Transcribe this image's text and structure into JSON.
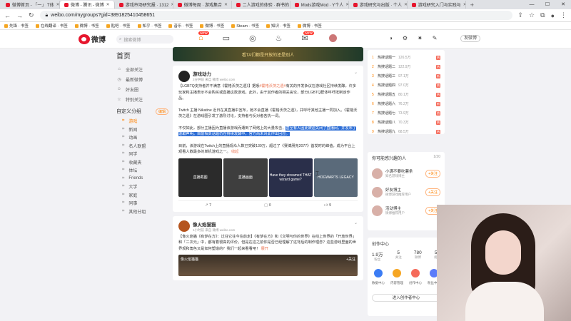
{
  "browser": {
    "tabs": [
      {
        "label": "微博首页 - 「一」 T体",
        "active": false
      },
      {
        "label": "微博 - 腾讯 - 微博",
        "active": true
      },
      {
        "label": "游戏市场研究报 · 1312",
        "active": false
      },
      {
        "label": "微博每周 · 游戏集合",
        "active": false
      },
      {
        "label": "二人游戏的体验 · 群书的",
        "active": false
      },
      {
        "label": "Mods游戏Mod · Y个人",
        "active": false
      },
      {
        "label": "游戏研究与出版 · 个人",
        "active": false
      },
      {
        "label": "游戏研究入门与实践与",
        "active": false
      }
    ],
    "url": "weibo.com/mygroups?gid=3891825410458651",
    "bookmarks": [
      "先锋 · 书签",
      "在线翻译 · 书签",
      "微博 · 书签",
      "贴吧 · 书签",
      "知乎 · 书签",
      "音乐 · 书签",
      "微博 · 书签",
      "Steam · 书签",
      "知识 · 书签",
      "微博 · 书签"
    ]
  },
  "header": {
    "logo_text": "微博",
    "search_placeholder": "搜索微博",
    "home_badge": "NEW",
    "msg_badge": "NEW",
    "right_button": "发微博"
  },
  "leftnav": {
    "title": "首页",
    "items": [
      {
        "icon": "home-icon",
        "label": "全部关注"
      },
      {
        "icon": "latest-icon",
        "label": "最新微博"
      },
      {
        "icon": "friend-icon",
        "label": "好友圈"
      },
      {
        "icon": "special-icon",
        "label": "特别关注"
      }
    ],
    "group_title": "自定义分组",
    "group_edit": "编辑",
    "groups": [
      {
        "label": "游戏",
        "selected": true
      },
      {
        "label": "新闻",
        "selected": false
      },
      {
        "label": "动画",
        "selected": false
      },
      {
        "label": "名人联盟",
        "selected": false
      },
      {
        "label": "同学",
        "selected": false
      },
      {
        "label": "收藏夹",
        "selected": false
      },
      {
        "label": "体坛",
        "selected": false
      },
      {
        "label": "Friends",
        "selected": false
      },
      {
        "label": "大学",
        "selected": false
      },
      {
        "label": "家庭",
        "selected": false
      },
      {
        "label": "同事",
        "selected": false
      },
      {
        "label": "其他分组",
        "selected": false
      }
    ]
  },
  "feed": {
    "banner": "看TA们都是开放的还是别人",
    "post1": {
      "author": "游戏动力",
      "meta": "2分钟前 来自 微博 weibo.com",
      "text1": "【LGBTQ支持者并不满意《霍格沃茨之遗》】据悉",
      "tag": "#霍格沃茨之遗#",
      "text1b": "有关的开发争议在游戏社区持续发酵，许多玩家和主播表示不会购买或直播这款游戏。此外，由于其作者的相关言论，部分LGBTQ群体呼吁抵制该作品。",
      "text2": "Twitch 主播 Nikatine 近日在其直播中宣布，她不会直播《霍格沃茨之遗》，并呼吁其他主播一同加入。《霍格沃茨之遗》在游戏圈引发了激烈讨论，支持者与反对者各执一词。",
      "text3": "不仅如此，部分主播因为直播该游戏而遭到了网络上的大量攻击，",
      "highlight": "甚至有人因此被迫关闭了直播间，并发布了道歉声明。目前相关话题仍在持续发酵中，官方尚未对此作出回应。",
      "text4": "目前，该游戏在Twitch上的直播观众人数已突破130万，超过了《赛博朋克2077》首发时的峰值，成为平台上观看人数最多的单机游戏之一。",
      "text4_link": "收起",
      "pics": [
        "直播截图",
        "直播画面",
        "Have they streamed THAT wizard game?",
        "HOGWARTS LEGACY"
      ],
      "actions": {
        "share": "7",
        "comment": "0",
        "like": "9"
      }
    },
    "post2": {
      "author": "像火焰猫猫",
      "meta": "1小时前 来自 微博 weibo.com",
      "text": "【像火焰猫《有梦在方》：过往它往今往前走】《有梦在方》和《文明与你的世界》在线上世界的「开放世界」和「二次元」中，都有着很高的评价。但是在这之前你是否已经理解了这背后的制作理念？这些游戏里面的世界观和角色又是如何塑造的？我们一起来看看吧！",
      "text_link": "展开",
      "video_label": "像火焰猫猫",
      "video_tag": "+关注"
    }
  },
  "hotlist": [
    {
      "n": "1",
      "title": "热搜话题一",
      "value": "126.5万",
      "tag": "热"
    },
    {
      "n": "2",
      "title": "热搜话题二",
      "value": "122.9万",
      "tag": "热"
    },
    {
      "n": "3",
      "title": "热搜话题三",
      "value": "97.1万",
      "tag": "新"
    },
    {
      "n": "4",
      "title": "热搜话题四",
      "value": "97.0万",
      "tag": "热"
    },
    {
      "n": "5",
      "title": "热搜话题五",
      "value": "80.1万",
      "tag": "热"
    },
    {
      "n": "6",
      "title": "热搜话题六",
      "value": "76.2万",
      "tag": "新"
    },
    {
      "n": "7",
      "title": "热搜话题七",
      "value": "73.9万",
      "tag": "热"
    },
    {
      "n": "8",
      "title": "热搜话题八",
      "value": "70.3万",
      "tag": "热"
    },
    {
      "n": "9",
      "title": "热搜话题九",
      "value": "68.5万",
      "tag": "热"
    }
  ],
  "recommend": {
    "title": "你可能感兴趣的人",
    "page": "1/20",
    "users": [
      {
        "name": "小满不要吃薯条",
        "desc": "知名游戏博主",
        "follow": "+关注"
      },
      {
        "name": "好友博主",
        "desc": "微博游戏推荐用户",
        "follow": "+关注"
      },
      {
        "name": "活动博主",
        "desc": "微博推荐用户",
        "follow": "+关注"
      }
    ]
  },
  "creator": {
    "title": "创作中心",
    "stats": [
      {
        "v": "1.9万",
        "l": "粉丝"
      },
      {
        "v": "5",
        "l": "关注"
      },
      {
        "v": "780",
        "l": "微博"
      },
      {
        "v": "52",
        "l": "视频"
      }
    ],
    "tools": [
      "数据中心",
      "内容管理",
      "创作中心",
      "粉丝中心"
    ],
    "button": "进入创作者中心"
  }
}
